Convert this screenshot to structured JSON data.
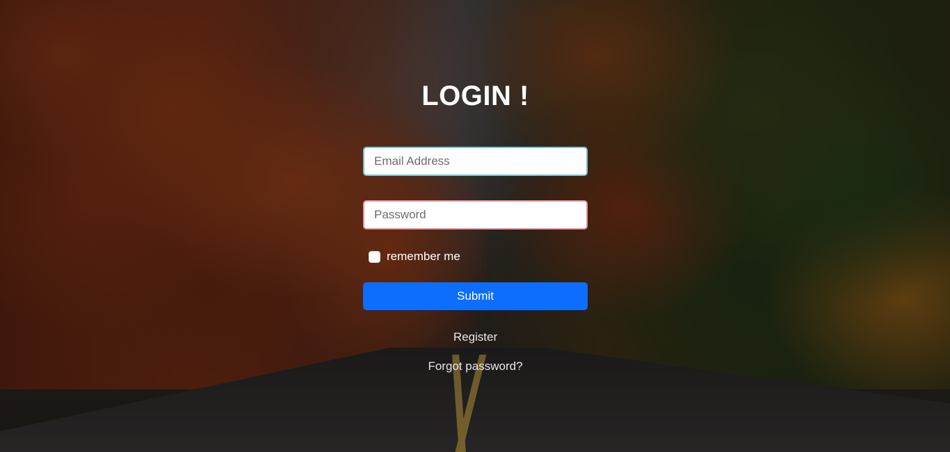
{
  "background": {
    "description_icon": "autumn-forest-road-image"
  },
  "login": {
    "title": "LOGIN !",
    "email_placeholder": "Email Address",
    "password_placeholder": "Password",
    "remember_label": "remember me",
    "submit_label": "Submit",
    "register_label": "Register",
    "forgot_label": "Forgot password?"
  },
  "colors": {
    "submit_button": "#0d6efd",
    "email_border": "#79c6d3",
    "password_border": "#e79aa4",
    "text": "#ffffff"
  }
}
